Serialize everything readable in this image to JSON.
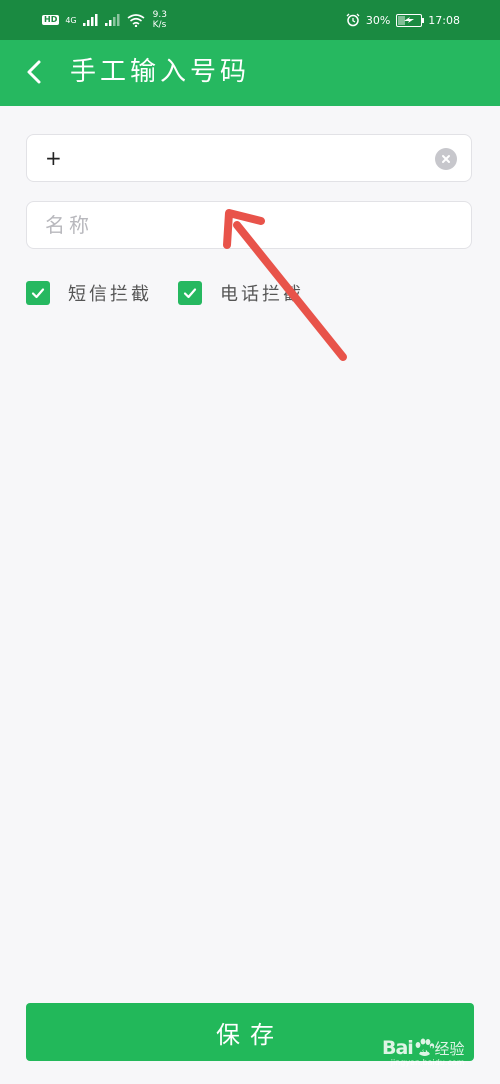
{
  "status_bar": {
    "hd_label": "HD",
    "network_label": "4G",
    "speed_value": "9.3",
    "speed_unit": "K/s",
    "battery_text": "30%",
    "battery_level": 0.3,
    "time": "17:08",
    "icons": [
      "signal-icon",
      "wifi-icon",
      "alarm-icon",
      "battery-icon"
    ]
  },
  "app_bar": {
    "title": "手工输入号码",
    "back_icon": "chevron-left-icon"
  },
  "form": {
    "phone_value": "+",
    "name_placeholder": "名称",
    "checkboxes": [
      {
        "label": "短信拦截",
        "checked": true
      },
      {
        "label": "电话拦截",
        "checked": true
      }
    ]
  },
  "save_label": "保存",
  "watermark": {
    "brand": "Bai",
    "paw": "du",
    "sub": "经验",
    "url": "jingyan.baidu.com"
  },
  "colors": {
    "status_bar": "#1a8a41",
    "accent": "#26b860",
    "background": "#f7f7f9",
    "annotation": "#e8534a"
  }
}
